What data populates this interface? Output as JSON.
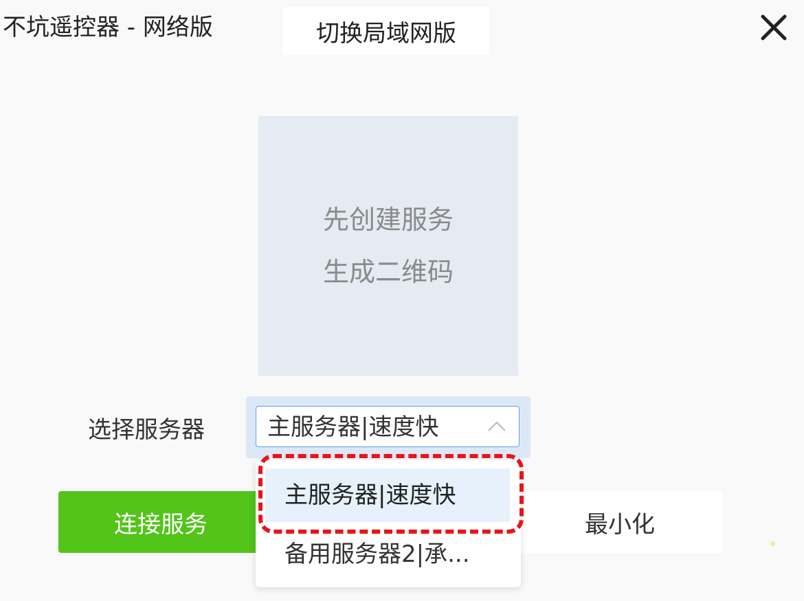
{
  "window": {
    "title": "不坑遥控器 - 网络版",
    "switch_button_label": "切换局域网版",
    "close_icon": "close-icon"
  },
  "qr_placeholder": {
    "line1": "先创建服务",
    "line2": "生成二维码"
  },
  "server": {
    "label": "选择服务器",
    "selected_value": "主服务器|速度快",
    "options": [
      {
        "label": "主服务器|速度快",
        "highlighted": true
      },
      {
        "label": "备用服务器2|承..."
      }
    ],
    "chevron_icon": "chevron-up-icon"
  },
  "actions": {
    "connect_label": "连接服务",
    "minimize_label": "最小化"
  },
  "colors": {
    "primary_green": "#52c41a",
    "select_border": "#5ea0ee",
    "highlight_annotation": "#e8141b",
    "qr_background": "#e4ebf2"
  }
}
